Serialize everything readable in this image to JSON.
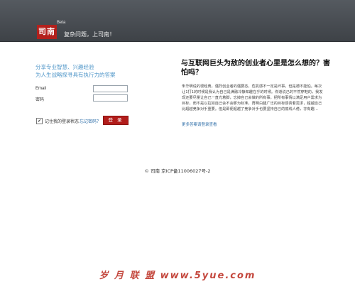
{
  "header": {
    "logo_text": "司南",
    "beta_label": "Beta",
    "slogan": "复杂问题，上司南！"
  },
  "intro": {
    "line1": "分享专业智慧、兴趣经验",
    "line2": "为人生战略探寻具有执行力的答案"
  },
  "login": {
    "email_label": "Email",
    "email_value": "",
    "password_label": "密码",
    "password_value": "",
    "remember_label": "记住我的登录状态",
    "remember_checked": "✔",
    "forgot_link": "忘记密码？",
    "submit_label": "登 录"
  },
  "article": {
    "title": "与互联网巨头为敌的创业者心里是怎么想的？害怕吗？",
    "body": "朱华明说的很经典，强烈创业者的强要态，危机感不一定是坏事，但是德不能怕。每次让1打1的时候是我认为自己是满融冷静知趣在乎的时候。你道说己的不然穿鞋的，我发现还要尽量让自己一直光着脚，忘掉自己会做的所有事，把所有事情以满足用户需求为目标，而不是以拉如自己会不会那为标准，再明白腿广泛的目标感贵着需求，超越自己比超越竞争对手重要。但是即便超越了竞争对手也要坚持自己的底线人倦，亦有趣…",
    "more_link": "更多答案请登录查看"
  },
  "footer": {
    "text": "© 司南 京ICP备11006027号-2"
  },
  "watermark": {
    "text": "岁 月 联 盟   www.5yue.com"
  }
}
